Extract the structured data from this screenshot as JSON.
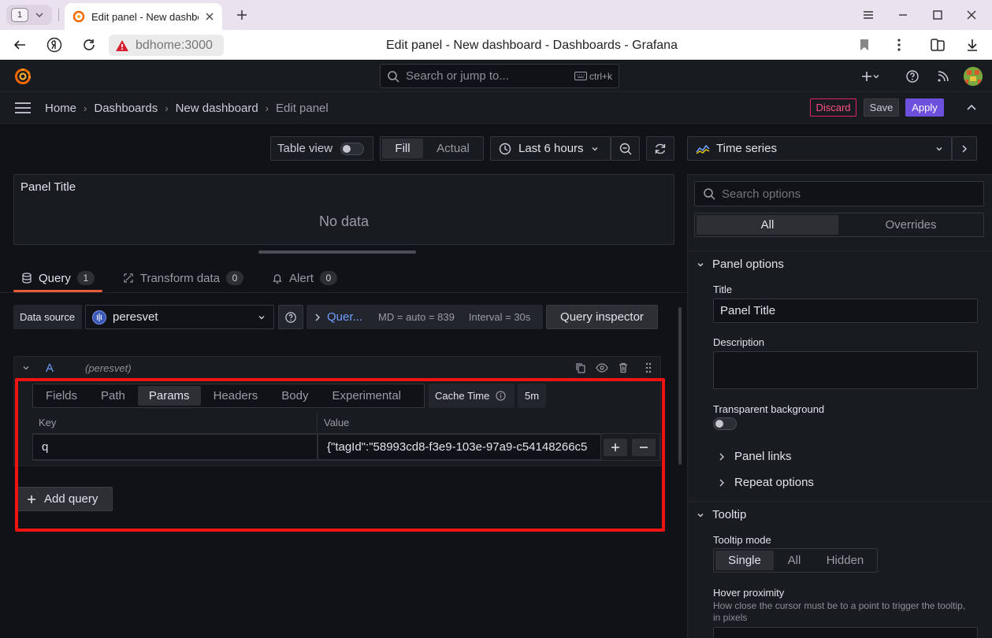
{
  "browser": {
    "tab_count": "1",
    "tab_title": "Edit panel - New dashboard - Dashboards - Grafana",
    "url": "bdhome:3000",
    "page_title": "Edit panel - New dashboard - Dashboards - Grafana"
  },
  "topbar": {
    "search_placeholder": "Search or jump to...",
    "search_shortcut": "ctrl+k"
  },
  "breadcrumbs": [
    "Home",
    "Dashboards",
    "New dashboard",
    "Edit panel"
  ],
  "actions": {
    "discard": "Discard",
    "save": "Save",
    "apply": "Apply"
  },
  "toolbar": {
    "table_view": "Table view",
    "fill": "Fill",
    "actual": "Actual",
    "time_range": "Last 6 hours",
    "visualization": "Time series"
  },
  "preview": {
    "title": "Panel Title",
    "empty": "No data"
  },
  "tabs": [
    {
      "label": "Query",
      "count": "1"
    },
    {
      "label": "Transform data",
      "count": "0"
    },
    {
      "label": "Alert",
      "count": "0"
    }
  ],
  "query": {
    "datasource_label": "Data source",
    "datasource": "peresvet",
    "options_link": "Quer...",
    "md": "MD = auto = 839",
    "interval": "Interval = 30s",
    "inspector": "Query inspector",
    "ref_id": "A",
    "ref_ds": "(peresvet)",
    "subtabs": [
      "Fields",
      "Path",
      "Params",
      "Headers",
      "Body",
      "Experimental"
    ],
    "active_subtab": "Params",
    "cache_label": "Cache Time",
    "cache_value": "5m",
    "columns": {
      "key": "Key",
      "value": "Value"
    },
    "params": [
      {
        "key": "q",
        "value": "{\"tagId\":\"58993cd8-f3e9-103e-97a9-c54148266c5"
      }
    ],
    "add_query": "Add query"
  },
  "options": {
    "search_placeholder": "Search options",
    "filter_all": "All",
    "filter_overrides": "Overrides",
    "panel_options": "Panel options",
    "title_label": "Title",
    "title_value": "Panel Title",
    "description_label": "Description",
    "transparent_label": "Transparent background",
    "panel_links": "Panel links",
    "repeat_options": "Repeat options",
    "tooltip": "Tooltip",
    "tooltip_mode_label": "Tooltip mode",
    "tooltip_modes": [
      "Single",
      "All",
      "Hidden"
    ],
    "hover_label": "Hover proximity",
    "hover_desc": "How close the cursor must be to a point to trigger the tooltip, in pixels"
  },
  "colors": {
    "apply": "#6e50df",
    "discard": "#ff5286",
    "tab_underline": "#e85b3a",
    "highlight_box": "#ef1313",
    "link": "#6e9fff"
  }
}
